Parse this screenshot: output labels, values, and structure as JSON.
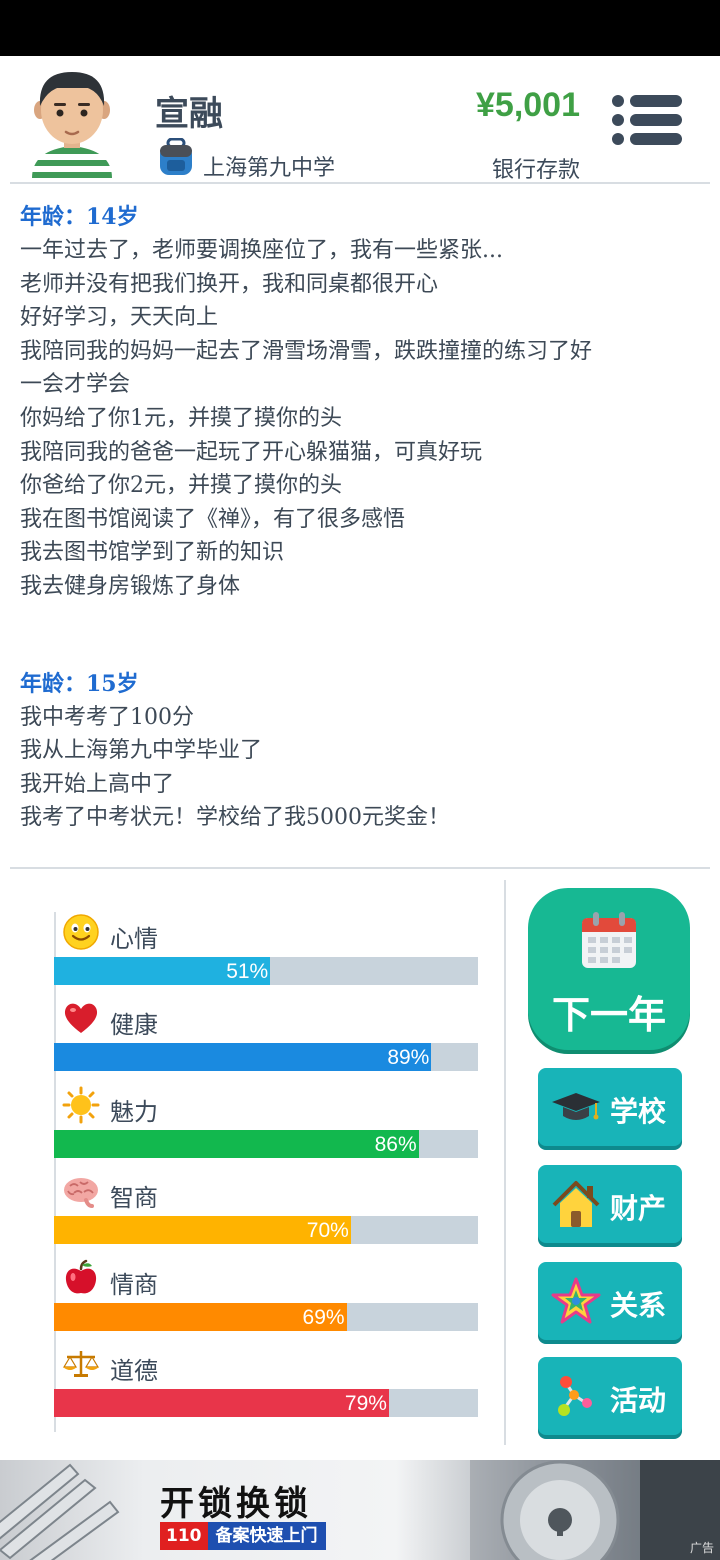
{
  "header": {
    "name": "宣融",
    "school": "上海第九中学",
    "money": "¥5,001",
    "money_label": "银行存款"
  },
  "log": [
    {
      "age_title": "年龄：14岁",
      "lines": [
        "一年过去了，老师要调换座位了，我有一些紧张...",
        "老师并没有把我们换开，我和同桌都很开心",
        "好好学习，天天向上",
        "我陪同我的妈妈一起去了滑雪场滑雪，跌跌撞撞的练习了好",
        "一会才学会",
        "你妈给了你1元，并摸了摸你的头",
        "我陪同我的爸爸一起玩了开心躲猫猫，可真好玩",
        "你爸给了你2元，并摸了摸你的头",
        "我在图书馆阅读了《禅》，有了很多感悟",
        "我去图书馆学到了新的知识",
        "我去健身房锻炼了身体"
      ]
    },
    {
      "age_title": "年龄：15岁",
      "lines": [
        "我中考考了100分",
        "我从上海第九中学毕业了",
        "我开始上高中了",
        "我考了中考状元！学校给了我5000元奖金！"
      ]
    }
  ],
  "stats": [
    {
      "label": "心情",
      "value": 51,
      "text": "51%",
      "color": "#1fb1e0",
      "icon": "smiley-icon"
    },
    {
      "label": "健康",
      "value": 89,
      "text": "89%",
      "color": "#1a8ae0",
      "icon": "heart-icon"
    },
    {
      "label": "魅力",
      "value": 86,
      "text": "86%",
      "color": "#12b84e",
      "icon": "sun-icon"
    },
    {
      "label": "智商",
      "value": 70,
      "text": "70%",
      "color": "#ffb300",
      "icon": "brain-icon"
    },
    {
      "label": "情商",
      "value": 69,
      "text": "69%",
      "color": "#ff8a00",
      "icon": "apple-icon"
    },
    {
      "label": "道德",
      "value": 79,
      "text": "79%",
      "color": "#e8354a",
      "icon": "scales-icon"
    }
  ],
  "buttons": {
    "next_year": "下一年",
    "school": "学校",
    "property": "财产",
    "relations": "关系",
    "activities": "活动"
  },
  "ad": {
    "title": "开锁换锁",
    "number": "110",
    "desc": "备案快速上门",
    "tag": "广告"
  },
  "colors": {
    "primary_text": "#3c4a5a",
    "age_title": "#1f6bd0",
    "money": "#3fa045",
    "next_year_button": "#17b893",
    "side_button": "#18b4b8"
  }
}
